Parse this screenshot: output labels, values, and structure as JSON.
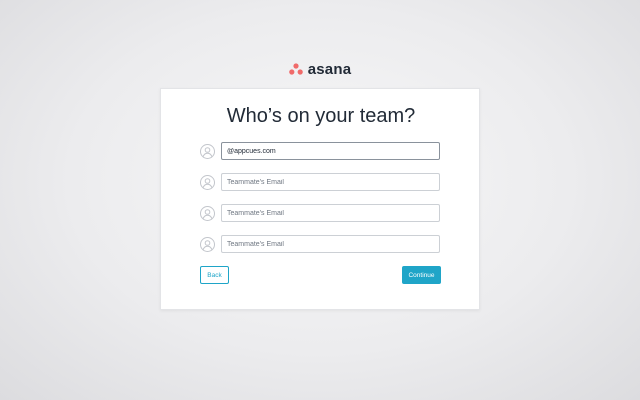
{
  "brand": {
    "name": "asana",
    "accent_color": "#f06a6a"
  },
  "card": {
    "title": "Who’s on your team?",
    "invite_fields": [
      {
        "value": "@appcues.com",
        "placeholder": "Teammate's Email",
        "icon": "person-icon"
      },
      {
        "value": "",
        "placeholder": "Teammate's Email",
        "icon": "person-icon"
      },
      {
        "value": "",
        "placeholder": "Teammate's Email",
        "icon": "person-icon"
      },
      {
        "value": "",
        "placeholder": "Teammate's Email",
        "icon": "person-icon"
      }
    ],
    "back_label": "Back",
    "continue_label": "Continue",
    "button_color": "#1fa5c8"
  }
}
